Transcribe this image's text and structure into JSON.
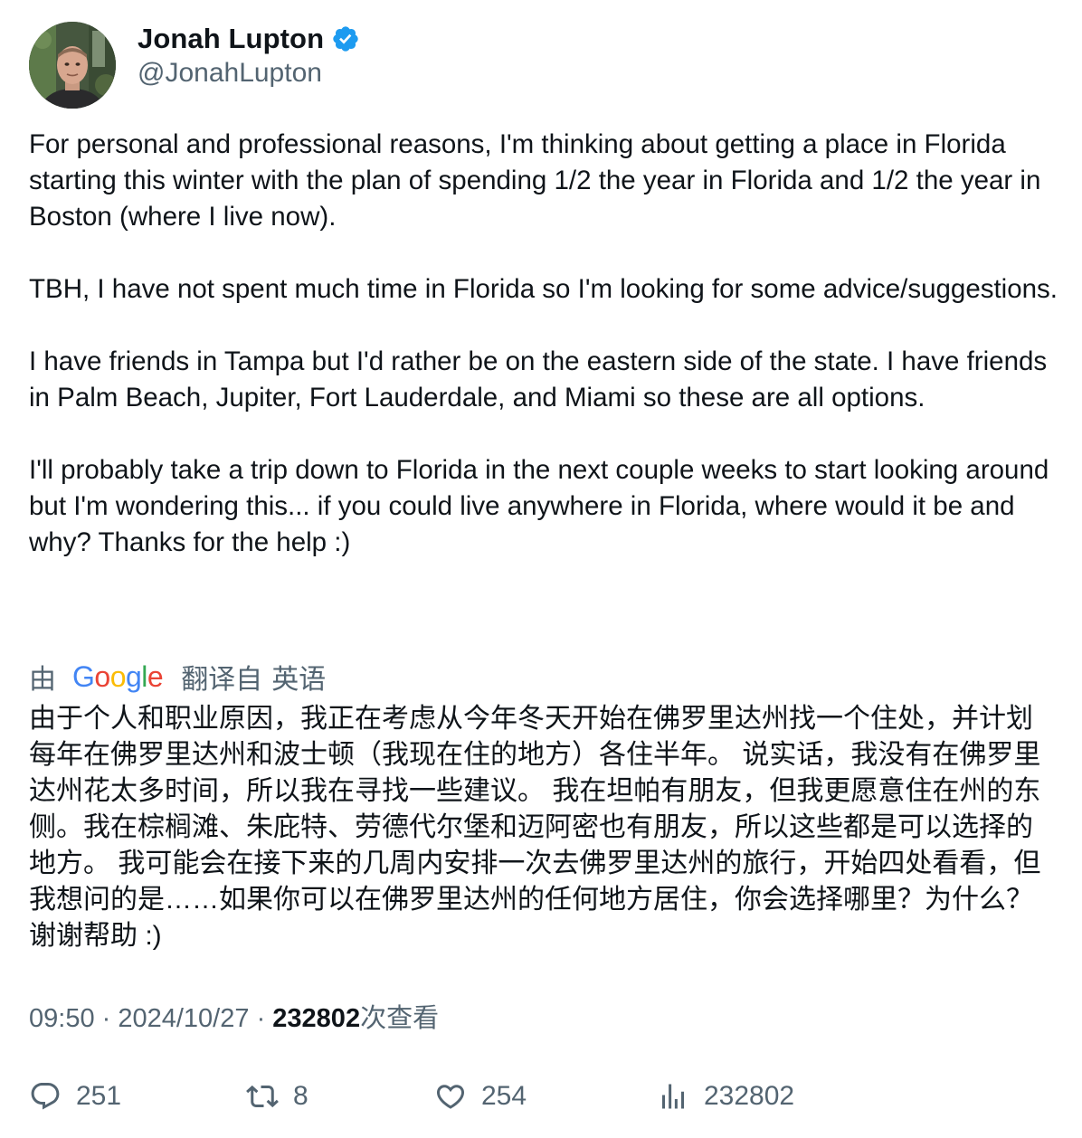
{
  "author": {
    "display_name": "Jonah Lupton",
    "handle": "@JonahLupton",
    "verified_icon": "verified-badge-icon",
    "verified_color": "#1d9bf0"
  },
  "tweet": {
    "paragraphs": [
      "For personal and professional reasons, I'm thinking about getting a place in Florida starting this winter with the plan of spending 1/2 the year in Florida and 1/2 the year in Boston (where I live now).",
      "TBH, I have not spent much time in Florida so I'm looking for some advice/suggestions.",
      "I have friends in Tampa but I'd rather be on the eastern side of the state. I have friends in Palm Beach, Jupiter, Fort Lauderdale, and Miami so these are all options.",
      "I'll probably take a trip down to Florida in the next couple weeks to start looking around but I'm wondering this... if you could live anywhere in Florida, where would it be and why? Thanks for the help :)"
    ]
  },
  "translation": {
    "by": "由",
    "provider": "Google",
    "translated_from": "翻译自",
    "source_language": "英语",
    "text": "由于个人和职业原因，我正在考虑从今年冬天开始在佛罗里达州找一个住处，并计划每年在佛罗里达州和波士顿（我现在住的地方）各住半年。 说实话，我没有在佛罗里达州花太多时间，所以我在寻找一些建议。 我在坦帕有朋友，但我更愿意住在州的东侧。我在棕榈滩、朱庇特、劳德代尔堡和迈阿密也有朋友，所以这些都是可以选择的地方。 我可能会在接下来的几周内安排一次去佛罗里达州的旅行，开始四处看看，但我想问的是……如果你可以在佛罗里达州的任何地方居住，你会选择哪里？为什么？谢谢帮助 :)"
  },
  "meta": {
    "time": "09:50",
    "separator": " · ",
    "date": "2024/10/27",
    "views_count": "232802",
    "views_label": "次查看"
  },
  "actions": {
    "reply_icon": "reply-icon",
    "reply_count": "251",
    "retweet_icon": "retweet-icon",
    "retweet_count": "8",
    "like_icon": "heart-icon",
    "like_count": "254",
    "views_icon": "views-chart-icon",
    "views_count": "232802"
  }
}
